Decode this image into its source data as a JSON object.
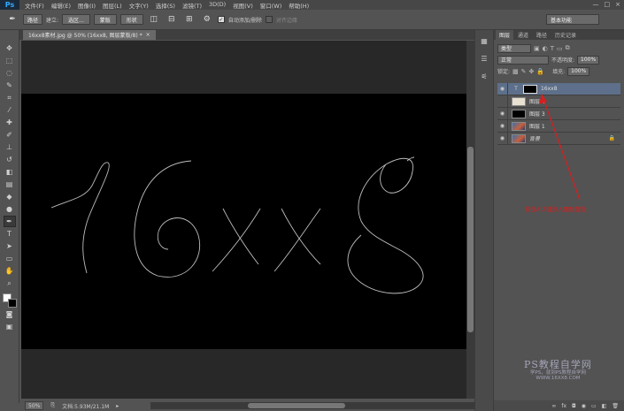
{
  "app": {
    "logo": "Ps"
  },
  "menu": [
    "文件(F)",
    "编辑(E)",
    "图像(I)",
    "图层(L)",
    "文字(Y)",
    "选择(S)",
    "滤镜(T)",
    "3D(D)",
    "视图(V)",
    "窗口(W)",
    "帮助(H)"
  ],
  "window_controls": [
    "—",
    "□",
    "×"
  ],
  "options": {
    "mode": "路径",
    "make_label": "建立:",
    "selection_btn": "选区...",
    "mask_btn": "蒙版",
    "shape_btn": "形状",
    "auto_add_delete": "自动添加/删除",
    "align_edges": "对齐边缘",
    "workspace": "基本功能"
  },
  "document": {
    "tab_title": "16xx8素材.jpg @ 50% (16xx8, 图层蒙版/8) *",
    "zoom": "50%",
    "doc_info": "文档:5.93M/21.1M",
    "artwork_text": "16xx8"
  },
  "layers_panel": {
    "tabs": [
      "图层",
      "通道",
      "路径",
      "历史记录"
    ],
    "filter_kind": "类型",
    "blend_mode": "正常",
    "opacity_label": "不透明度:",
    "opacity": "100%",
    "lock_label": "锁定:",
    "fill_label": "填充:",
    "fill": "100%",
    "layers": [
      {
        "name": "16xx8",
        "type": "text",
        "selected": true,
        "visible": true
      },
      {
        "name": "图层 4",
        "type": "white",
        "selected": false,
        "visible": false
      },
      {
        "name": "图层 3",
        "type": "black",
        "selected": false,
        "visible": true
      },
      {
        "name": "图层 1",
        "type": "photo",
        "selected": false,
        "visible": true
      },
      {
        "name": "背景",
        "type": "photo",
        "selected": false,
        "visible": true,
        "locked": true
      }
    ],
    "footer_icons": [
      "∞",
      "fx",
      "◘",
      "◉",
      "▭",
      "◧",
      "🗑"
    ]
  },
  "annotation": "按住ALT键添入图层蒙版",
  "watermark": {
    "title": "PS教程自学网",
    "line1": "学PS，就到PS教程自学网",
    "line2": "WWW.16XX8.COM"
  },
  "colors": {
    "bg": "#535353",
    "canvas_bg": "#282828",
    "document": "#000000",
    "selected_layer": "#5d6f8a",
    "annotation": "#d42020"
  }
}
